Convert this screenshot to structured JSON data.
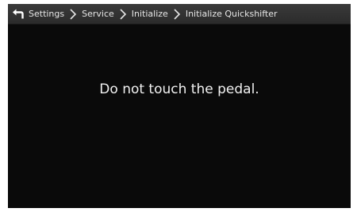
{
  "header": {
    "back_icon": "back-arrow-icon",
    "breadcrumb": [
      "Settings",
      "Service",
      "Initialize",
      "Initialize Quickshifter"
    ]
  },
  "main": {
    "message": "Do not touch the pedal."
  },
  "colors": {
    "background": "#0a0a0a",
    "header_bar": "#333333",
    "text": "#f2f2f2"
  }
}
